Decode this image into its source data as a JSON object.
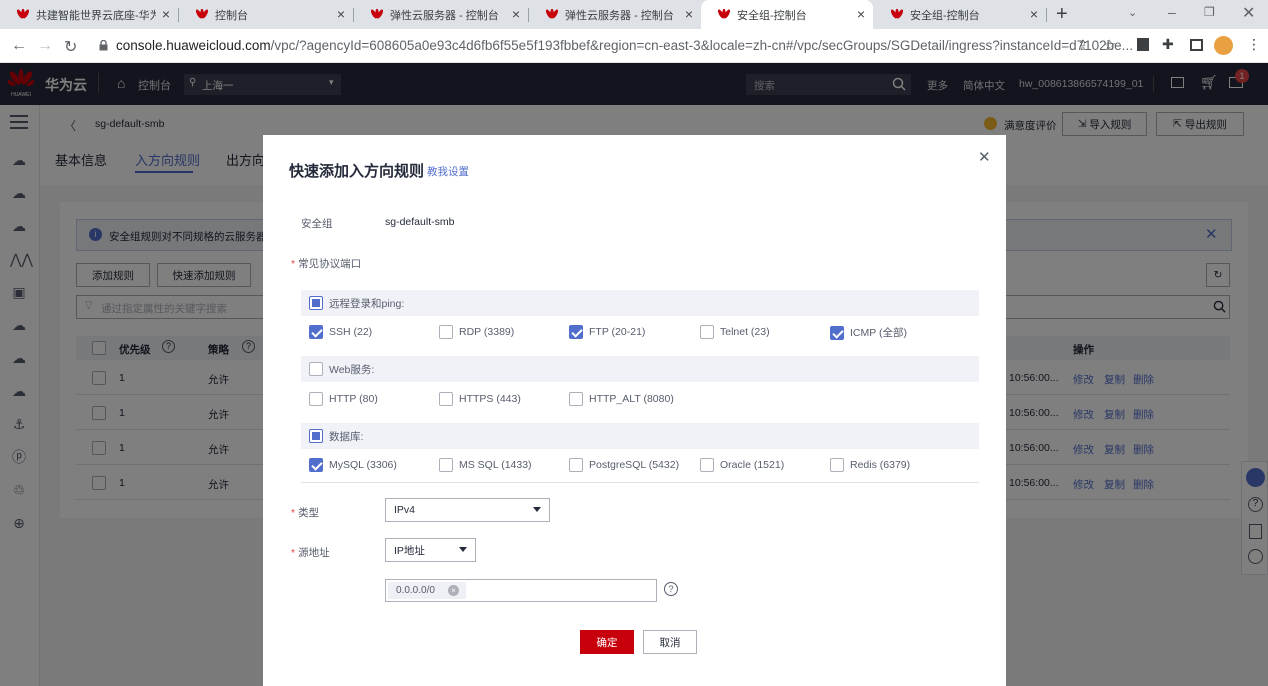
{
  "browser": {
    "tabs": [
      {
        "title": "共建智能世界云底座-华为云"
      },
      {
        "title": "控制台"
      },
      {
        "title": "弹性云服务器 - 控制台"
      },
      {
        "title": "弹性云服务器 - 控制台"
      },
      {
        "title": "安全组-控制台"
      },
      {
        "title": "安全组-控制台"
      }
    ],
    "url_host": "console.huaweicloud.com",
    "url_rest": "/vpc/?agencyId=608605a0e93c4d6fb6f55e5f193fbbef&region=cn-east-3&locale=zh-cn#/vpc/secGroups/SGDetail/ingress?instanceId=d7102be..."
  },
  "header": {
    "logo_text": "HUAWEI",
    "brand": "华为云",
    "console": "控制台",
    "region": "上海一",
    "search_placeholder": "搜索",
    "more": "更多",
    "lang": "简体中文",
    "user": "hw_008613866574199_01",
    "notif_count": "1"
  },
  "page": {
    "breadcrumb": "sg-default-smb",
    "satisfaction": "满意度评价",
    "import_rules": "导入规则",
    "export_rules": "导出规则",
    "tabs": [
      "基本信息",
      "入方向规则",
      "出方向"
    ],
    "info_text": "安全组规则对不同规格的云服务器生",
    "add_rule": "添加规则",
    "quick_add_rule": "快速添加规则",
    "filter_placeholder": "通过指定属性的关键字搜索",
    "col_priority": "优先级",
    "col_policy": "策略",
    "col_ops": "操作",
    "rows": [
      {
        "priority": "1",
        "policy": "允许",
        "time": "10:56:00...",
        "edit": "修改",
        "copy": "复制",
        "delete": "删除"
      },
      {
        "priority": "1",
        "policy": "允许",
        "time": "10:56:00...",
        "edit": "修改",
        "copy": "复制",
        "delete": "删除"
      },
      {
        "priority": "1",
        "policy": "允许",
        "time": "10:56:00...",
        "edit": "修改",
        "copy": "复制",
        "delete": "删除"
      },
      {
        "priority": "1",
        "policy": "允许",
        "time": "10:56:00...",
        "edit": "修改",
        "copy": "复制",
        "delete": "删除"
      }
    ]
  },
  "modal": {
    "title": "快速添加入方向规则",
    "tutorial_link": "教我设置",
    "sg_label": "安全组",
    "sg_value": "sg-default-smb",
    "ports_label": "常见协议端口",
    "groups": [
      {
        "name": "远程登录和ping:",
        "state": "partial",
        "options": [
          {
            "label": "SSH (22)",
            "checked": true
          },
          {
            "label": "RDP (3389)",
            "checked": false
          },
          {
            "label": "FTP (20-21)",
            "checked": true
          },
          {
            "label": "Telnet (23)",
            "checked": false
          },
          {
            "label": "ICMP (全部)",
            "checked": true
          }
        ]
      },
      {
        "name": "Web服务:",
        "state": "none",
        "options": [
          {
            "label": "HTTP (80)",
            "checked": false
          },
          {
            "label": "HTTPS (443)",
            "checked": false
          },
          {
            "label": "HTTP_ALT (8080)",
            "checked": false
          }
        ]
      },
      {
        "name": "数据库:",
        "state": "partial",
        "options": [
          {
            "label": "MySQL (3306)",
            "checked": true
          },
          {
            "label": "MS SQL (1433)",
            "checked": false
          },
          {
            "label": "PostgreSQL (5432)",
            "checked": false
          },
          {
            "label": "Oracle (1521)",
            "checked": false
          },
          {
            "label": "Redis (6379)",
            "checked": false
          }
        ]
      }
    ],
    "type_label": "类型",
    "type_value": "IPv4",
    "source_label": "源地址",
    "source_type": "IP地址",
    "source_tag": "0.0.0.0/0",
    "confirm": "确定",
    "cancel": "取消"
  },
  "colors": {
    "accent": "#526ecc",
    "primary_button": "#c7000b",
    "header_bg": "#252b3a"
  }
}
